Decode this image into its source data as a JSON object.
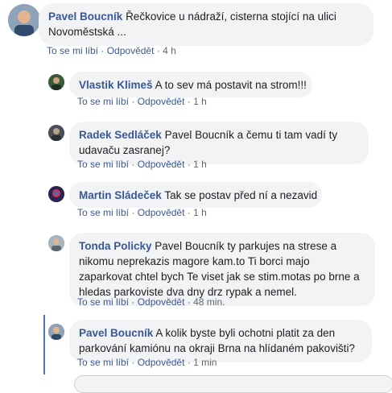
{
  "comments": [
    {
      "author": "Pavel Boucník",
      "text": "Řečkovice u nádraží, cisterna stojící na ulici Novoměstská ...",
      "like_label": "To se mi líbí",
      "reply_label": "Odpovědět",
      "time": "4 h"
    },
    {
      "author": "Vlastik Klimeš",
      "text": "A to sev má postavit na strom!!!",
      "like_label": "To se mi líbí",
      "reply_label": "Odpovědět",
      "time": "1 h"
    },
    {
      "author": "Radek Sedláček",
      "text": "Pavel Boucník a čemu ti tam vadí ty udavaču zasranej?",
      "like_label": "To se mi líbí",
      "reply_label": "Odpovědět",
      "time": "1 h"
    },
    {
      "author": "Martin Sládeček",
      "text": "Tak se postav před ní a nezavid",
      "like_label": "To se mi líbí",
      "reply_label": "Odpovědět",
      "time": "1 h"
    },
    {
      "author": "Tonda Policky",
      "text": "Pavel Boucník ty parkujes na strese a nikomu neprekazis magore kam.to Ti borci majo zaparkovat chtel bych Te viset jak se stim.motas po brne a hledas parkoviste dva dny drz rypak a nemel.",
      "like_label": "To se mi líbí",
      "reply_label": "Odpovědět",
      "time": "48 min."
    },
    {
      "author": "Pavel Boucník",
      "text": "A kolik byste byli ochotni platit za den parkování kamiónu na okraji Brna na hlídaném pakovišti?",
      "like_label": "To se mi líbí",
      "reply_label": "Odpovědět",
      "time": "1 min"
    }
  ],
  "separator": "·",
  "colors": {
    "link": "#385898",
    "bubble": "#f2f3f5",
    "meta": "#606770",
    "thread_line": "#4a76c8"
  }
}
